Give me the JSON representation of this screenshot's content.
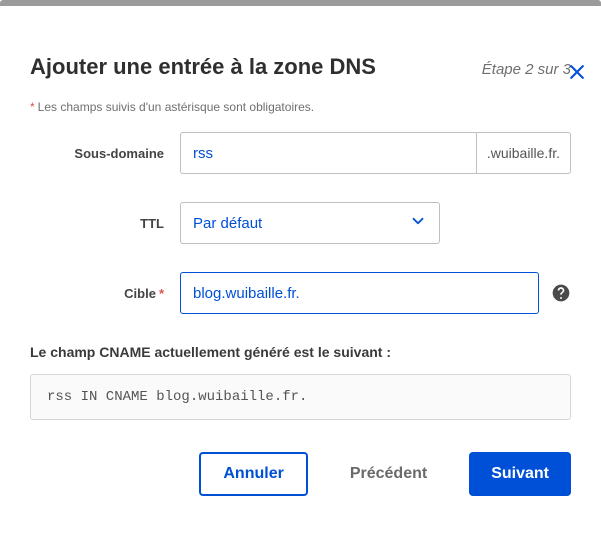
{
  "header": {
    "title": "Ajouter une entrée à la zone DNS",
    "step": "Étape 2 sur 3"
  },
  "required_note": "Les champs suivis d'un astérisque sont obligatoires.",
  "form": {
    "subdomain": {
      "label": "Sous-domaine",
      "value": "rss",
      "suffix": ".wuibaille.fr."
    },
    "ttl": {
      "label": "TTL",
      "value": "Par défaut"
    },
    "target": {
      "label": "Cible",
      "value": "blog.wuibaille.fr."
    }
  },
  "preview": {
    "label": "Le champ CNAME actuellement généré est le suivant :",
    "value": "rss IN CNAME blog.wuibaille.fr."
  },
  "buttons": {
    "cancel": "Annuler",
    "previous": "Précédent",
    "next": "Suivant"
  }
}
